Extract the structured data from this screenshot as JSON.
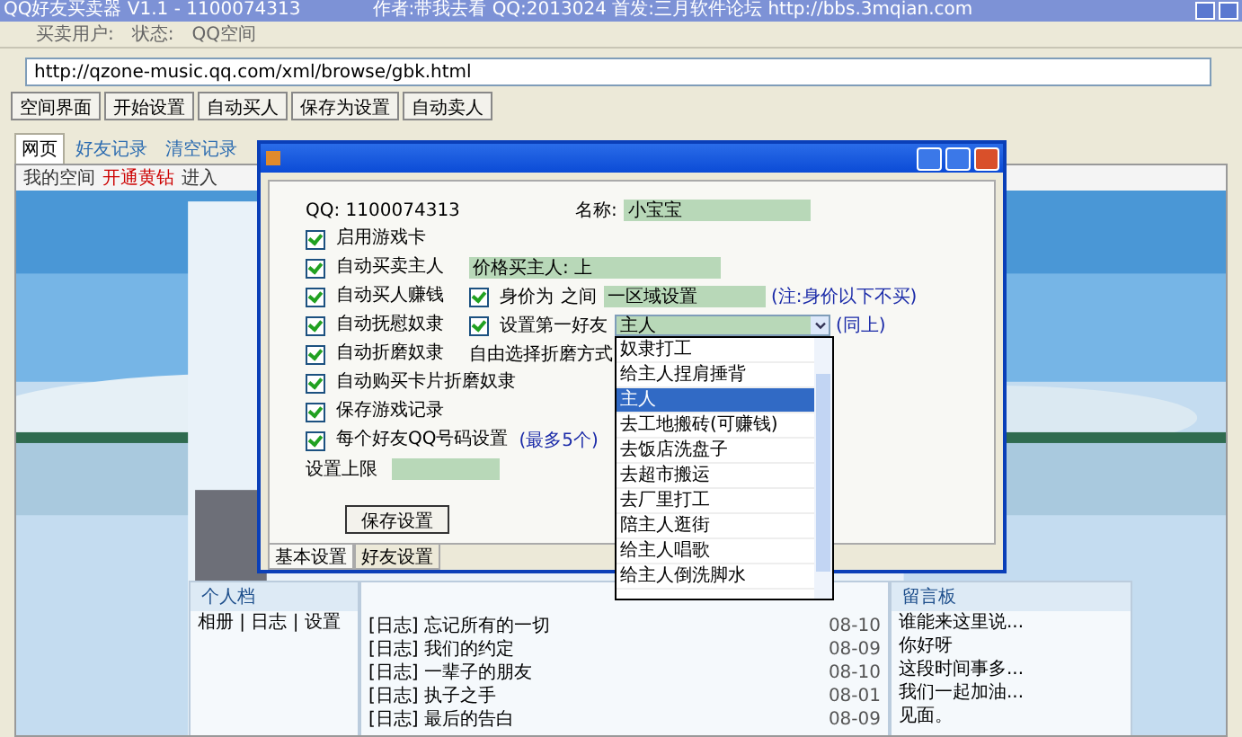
{
  "window": {
    "title": "QQ好友买卖器 V1.1 - 1100074313",
    "author": "作者:带我去看 QQ:2013024 首发:三月软件论坛 http://bbs.3mqian.com"
  },
  "menu": [
    "买卖用户:",
    "状态:",
    "QQ空间"
  ],
  "url": "http://qzone-music.qq.com/xml/browse/gbk.html",
  "toolbar": [
    "空间界面",
    "开始设置",
    "自动买人",
    "保存为设置",
    "自动卖人"
  ],
  "tabs": [
    {
      "label": "网页",
      "selected": true
    },
    {
      "label": "好友记录",
      "selected": false
    },
    {
      "label": "清空记录",
      "selected": false
    }
  ],
  "browser": {
    "links": [
      "我的空间",
      "开通黄钻",
      "进入"
    ],
    "sections": [
      {
        "title": "个人档",
        "lines": [
          "相册 | 日志 | 设置"
        ]
      },
      {
        "lines": [
          "[日志] 忘记所有的一切",
          "[日志] 我们的约定",
          "[日志] 一辈子的朋友",
          "[日志] 执子之手",
          "[日志] 最后的告白"
        ],
        "dates": [
          "08-10",
          "08-09",
          "08-10",
          "08-01",
          "08-09"
        ]
      },
      {
        "title": "留言板",
        "lines": [
          "谁能来这里说...",
          "你好呀",
          "这段时间事多...",
          "我们一起加油...",
          "见面。"
        ]
      }
    ]
  },
  "dialog": {
    "rows": [
      {
        "kind": "info",
        "label": "QQ: 1100074313",
        "field_label": "名称:",
        "value": "小宝宝"
      },
      {
        "kind": "check",
        "checked": true,
        "label": "启用游戏卡"
      },
      {
        "kind": "check_field",
        "checked": true,
        "label": "自动买卖主人",
        "value": "价格买主人: 上"
      },
      {
        "kind": "check_sub",
        "checked": true,
        "label": "自动买人赚钱",
        "sub": {
          "checked": true,
          "label": "身价为"
        },
        "text": "之间",
        "value": "一区域设置",
        "note": "(注:身价以下不买)"
      },
      {
        "kind": "check_select",
        "checked": true,
        "label": "自动抚慰奴隶",
        "sub": {
          "checked": true,
          "label": "设置第一好友"
        },
        "value": "主人",
        "note": "(同上)"
      },
      {
        "kind": "check_text",
        "checked": true,
        "label": "自动折磨奴隶",
        "text": "自由选择折磨方式"
      },
      {
        "kind": "check",
        "checked": true,
        "label": "自动购买卡片折磨奴隶"
      },
      {
        "kind": "check",
        "checked": true,
        "label": "保存游戏记录"
      },
      {
        "kind": "check_note",
        "checked": true,
        "label": "每个好友QQ号码设置",
        "note": "(最多5个)"
      },
      {
        "kind": "field",
        "label": "设置上限"
      }
    ],
    "button": "保存设置",
    "tabs": [
      {
        "label": "基本设置",
        "selected": true
      },
      {
        "label": "好友设置",
        "selected": false
      }
    ],
    "options": [
      {
        "label": "奴隶打工",
        "selected": false
      },
      {
        "label": "给主人捏肩捶背",
        "selected": false
      },
      {
        "label": "主人",
        "selected": true
      },
      {
        "label": "去工地搬砖(可赚钱)",
        "selected": false
      },
      {
        "label": "去饭店洗盘子",
        "selected": false
      },
      {
        "label": "去超市搬运",
        "selected": false
      },
      {
        "label": "去厂里打工",
        "selected": false
      },
      {
        "label": "陪主人逛街",
        "selected": false
      },
      {
        "label": "给主人唱歌",
        "selected": false
      },
      {
        "label": "给主人倒洗脚水",
        "selected": false
      }
    ]
  }
}
